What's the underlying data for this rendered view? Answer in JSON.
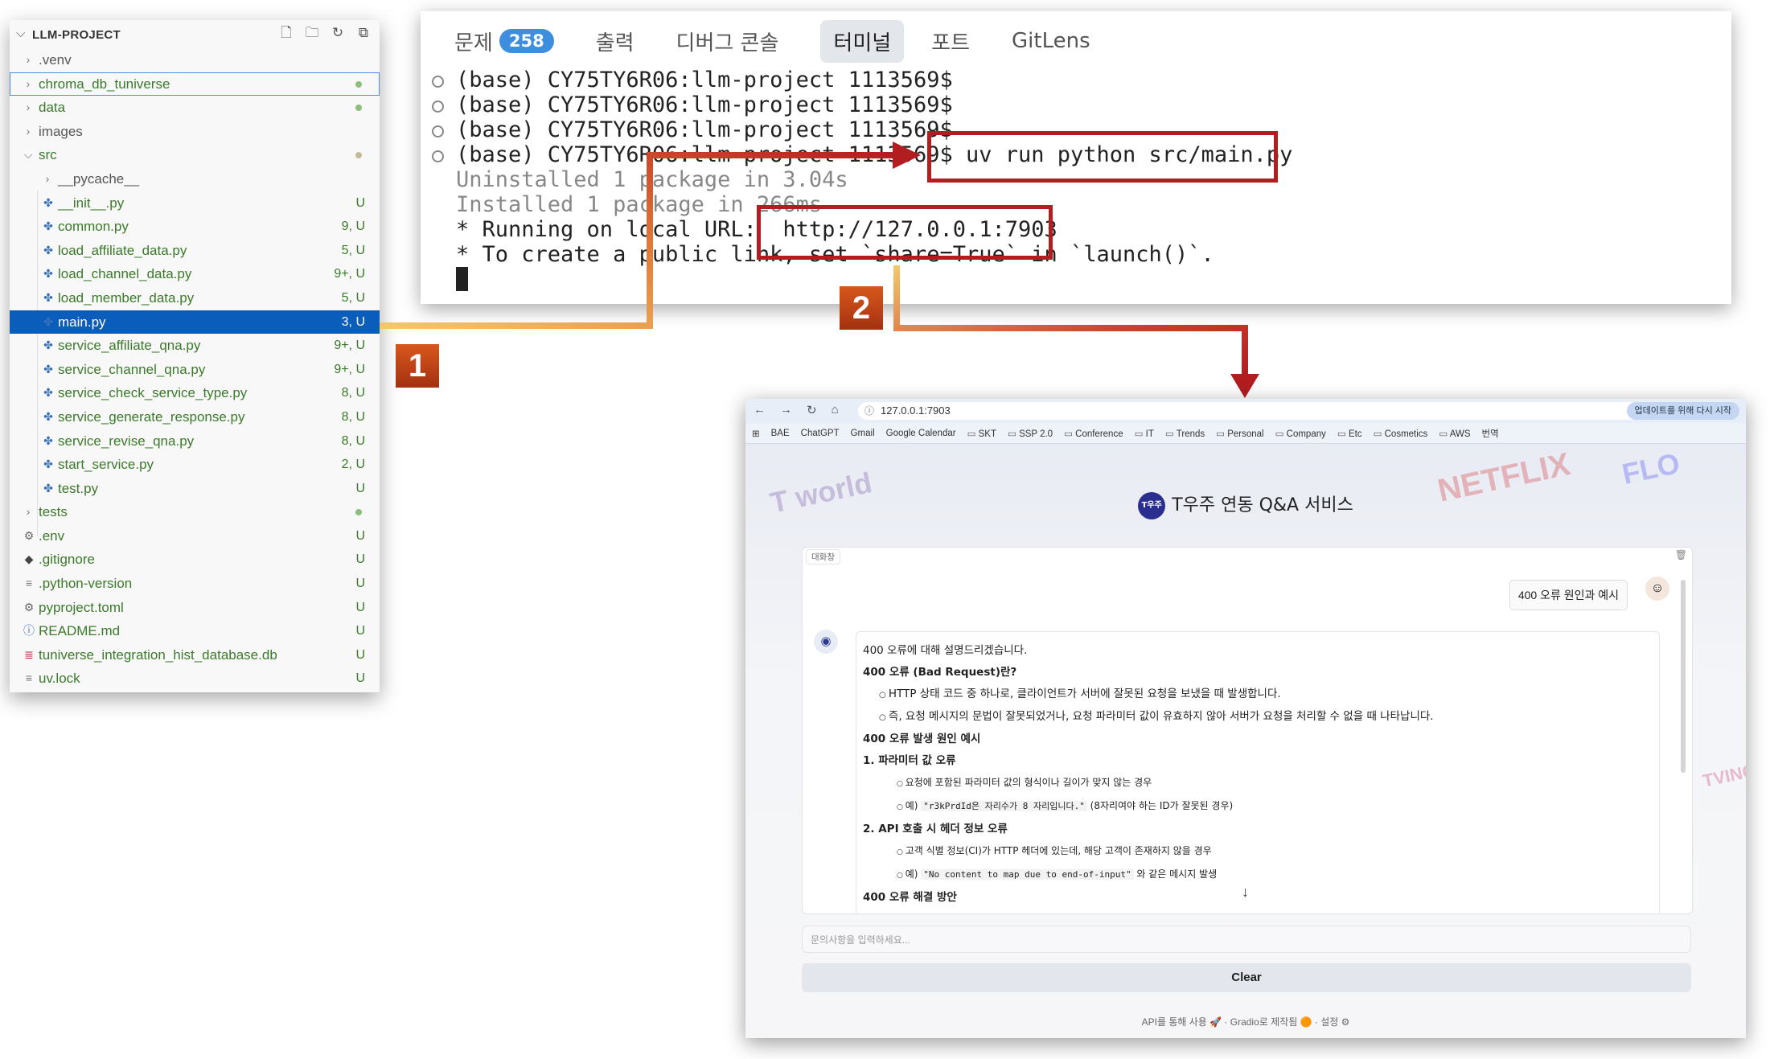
{
  "explorer": {
    "title": "LLM-PROJECT",
    "items": [
      {
        "name": ".venv",
        "status": "",
        "kind": "folder"
      },
      {
        "name": "chroma_db_tuniverse",
        "status": "",
        "kind": "folder"
      },
      {
        "name": "data",
        "status": "",
        "kind": "folder"
      },
      {
        "name": "images",
        "status": "",
        "kind": "folder"
      },
      {
        "name": "src",
        "status": "",
        "kind": "folder-open"
      },
      {
        "name": "__pycache__",
        "status": "",
        "kind": "folder"
      },
      {
        "name": "__init__.py",
        "status": "U",
        "kind": "py"
      },
      {
        "name": "common.py",
        "status": "9, U",
        "kind": "py"
      },
      {
        "name": "load_affiliate_data.py",
        "status": "5, U",
        "kind": "py"
      },
      {
        "name": "load_channel_data.py",
        "status": "9+, U",
        "kind": "py"
      },
      {
        "name": "load_member_data.py",
        "status": "5, U",
        "kind": "py"
      },
      {
        "name": "main.py",
        "status": "3, U",
        "kind": "py"
      },
      {
        "name": "service_affiliate_qna.py",
        "status": "9+, U",
        "kind": "py"
      },
      {
        "name": "service_channel_qna.py",
        "status": "9+, U",
        "kind": "py"
      },
      {
        "name": "service_check_service_type.py",
        "status": "8, U",
        "kind": "py"
      },
      {
        "name": "service_generate_response.py",
        "status": "8, U",
        "kind": "py"
      },
      {
        "name": "service_revise_qna.py",
        "status": "8, U",
        "kind": "py"
      },
      {
        "name": "start_service.py",
        "status": "2, U",
        "kind": "py"
      },
      {
        "name": "test.py",
        "status": "U",
        "kind": "py"
      },
      {
        "name": "tests",
        "status": "",
        "kind": "folder"
      },
      {
        "name": ".env",
        "status": "U",
        "kind": "gear"
      },
      {
        "name": ".gitignore",
        "status": "U",
        "kind": "git"
      },
      {
        "name": ".python-version",
        "status": "U",
        "kind": "file"
      },
      {
        "name": "pyproject.toml",
        "status": "U",
        "kind": "gear"
      },
      {
        "name": "README.md",
        "status": "U",
        "kind": "info"
      },
      {
        "name": "tuniverse_integration_hist_database.db",
        "status": "U",
        "kind": "db"
      },
      {
        "name": "uv.lock",
        "status": "U",
        "kind": "file"
      }
    ]
  },
  "terminal": {
    "tabs": {
      "problems": "문제",
      "problems_count": "258",
      "output": "출력",
      "debug": "디버그 콘솔",
      "terminal": "터미널",
      "ports": "포트",
      "gitlens": "GitLens"
    },
    "prompt": "(base) CY75TY6R06:llm-project 1113569$",
    "command": "uv run python src/main.py",
    "uninstalled": "Uninstalled 1 package in 3.04s",
    "installed": "Installed 1 package in 266ms",
    "running": "* Running on local URL:",
    "url": "http://127.0.0.1:7903",
    "share": "* To create a public link, set `share=True` in `launch()`."
  },
  "annotations": {
    "step1": "1",
    "step2": "2",
    "colors": {
      "box": "#b21d20",
      "badge": "#d8581d"
    }
  },
  "browser": {
    "url": "127.0.0.1:7903",
    "update_button": "업데이트를 위해 다시 시작",
    "bookmarks": [
      "BAE",
      "ChatGPT",
      "Gmail",
      "Google Calendar",
      "SKT",
      "SSP 2.0",
      "Conference",
      "IT",
      "Trends",
      "Personal",
      "Company",
      "Etc",
      "Cosmetics",
      "AWS",
      "번역"
    ],
    "app_title": "T우주 연동 Q&A 서비스",
    "logo_text": "T우주",
    "chat_label": "대화창",
    "user_message": "400 오류 원인과 예시",
    "bot": {
      "intro": "400 오류에 대해 설명드리겠습니다.",
      "h1": "400 오류 (Bad Request)란?",
      "b1": "HTTP 상태 코드 중 하나로, 클라이언트가 서버에 잘못된 요청을 보냈을 때 발생합니다.",
      "b2": "즉, 요청 메시지의 문법이 잘못되었거나, 요청 파라미터 값이 유효하지 않아 서버가 요청을 처리할 수 없을 때 나타납니다.",
      "h2": "400 오류 발생 원인 예시",
      "n1": "1. 파라미터 값 오류",
      "n1a": "요청에 포함된 파라미터 값의 형식이나 길이가 맞지 않는 경우",
      "n1b_pre": "예)",
      "n1b_code": "\"r3kPrdId은 자리수가 8 자리입니다.\"",
      "n1b_post": "(8자리여야 하는 ID가 잘못된 경우)",
      "n2": "2. API 호출 시 헤더 정보 오류",
      "n2a": "고객 식별 정보(CI)가 HTTP 헤더에 있는데, 해당 고객이 존재하지 않을 경우",
      "n2b_pre": "예)",
      "n2b_code": "\"No content to map due to end-of-input\"",
      "n2b_post": "와 같은 메시지 발생",
      "h3": "400 오류 해결 방안"
    },
    "input_placeholder": "문의사항을 입력하세요...",
    "clear": "Clear",
    "footer": "API를 통해 사용 🚀 · Gradio로 제작됨 🟠 · 설정 ⚙"
  }
}
